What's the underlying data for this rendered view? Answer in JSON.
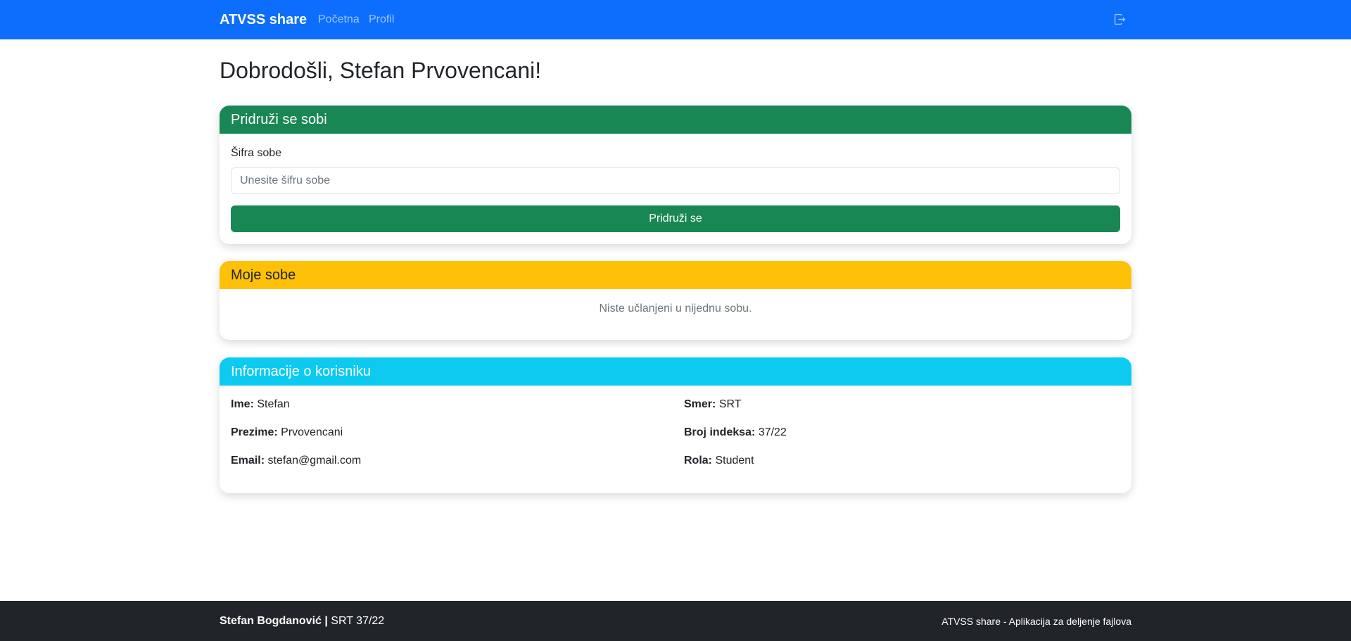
{
  "navbar": {
    "brand": "ATVSS share",
    "links": [
      "Početna",
      "Profil"
    ],
    "logout_icon": "logout-icon"
  },
  "page": {
    "title": "Dobrodošli, Stefan Prvovencani!"
  },
  "join_room": {
    "header": "Pridruži se sobi",
    "label": "Šifra sobe",
    "placeholder": "Unesite šifru sobe",
    "value": "",
    "button": "Pridruži se",
    "color": "#198754"
  },
  "my_rooms": {
    "header": "Moje sobe",
    "empty_text": "Niste učlanjeni u nijednu sobu.",
    "color": "#ffc107"
  },
  "user_info": {
    "header": "Informacije o korisniku",
    "color": "#0dcaf0",
    "fields": [
      {
        "label": "Ime:",
        "value": "Stefan"
      },
      {
        "label": "Prezime:",
        "value": "Prvovencani"
      },
      {
        "label": "Email:",
        "value": "stefan@gmail.com"
      },
      {
        "label": "Smer:",
        "value": "SRT"
      },
      {
        "label": "Broj indeksa:",
        "value": "37/22"
      },
      {
        "label": "Rola:",
        "value": "Student"
      }
    ]
  },
  "footer": {
    "author": "Stefan Bogdanović",
    "separator": "|",
    "index": "SRT 37/22",
    "app_description": "ATVSS share - Aplikacija za deljenje fajlova"
  }
}
